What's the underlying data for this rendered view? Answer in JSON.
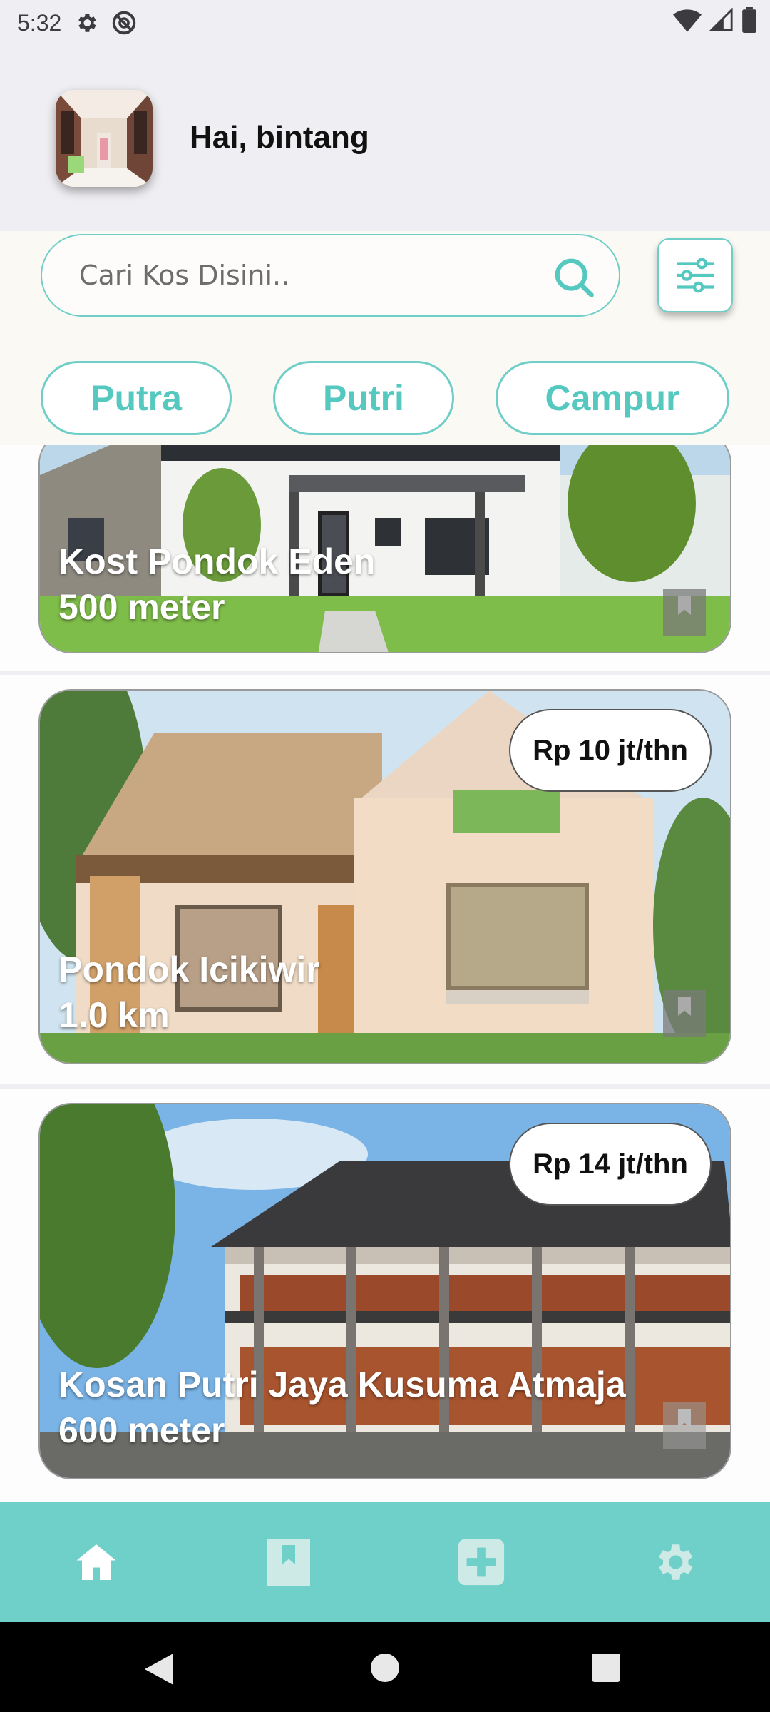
{
  "status_bar": {
    "time": "5:32"
  },
  "header": {
    "greeting": "Hai, bintang"
  },
  "search": {
    "placeholder": "Cari Kos Disini.."
  },
  "filters": [
    {
      "label": "Putra"
    },
    {
      "label": "Putri"
    },
    {
      "label": "Campur"
    }
  ],
  "listings": [
    {
      "name": "Kost Pondok Eden",
      "distance": "500 meter",
      "price": ""
    },
    {
      "name": "Pondok Icikiwir",
      "distance": "1.0 km",
      "price": "Rp 10 jt/thn"
    },
    {
      "name": "Kosan Putri Jaya Kusuma Atmaja",
      "distance": "600 meter",
      "price": "Rp 14 jt/thn"
    }
  ],
  "bottom_nav": [
    {
      "icon": "home-icon",
      "active": true
    },
    {
      "icon": "bookmark-icon",
      "active": false
    },
    {
      "icon": "add-icon",
      "active": false
    },
    {
      "icon": "settings-icon",
      "active": false
    }
  ],
  "colors": {
    "accent": "#6fd0c9",
    "chip_text": "#55c8c0",
    "nav_inactive": "#cde9e6"
  }
}
